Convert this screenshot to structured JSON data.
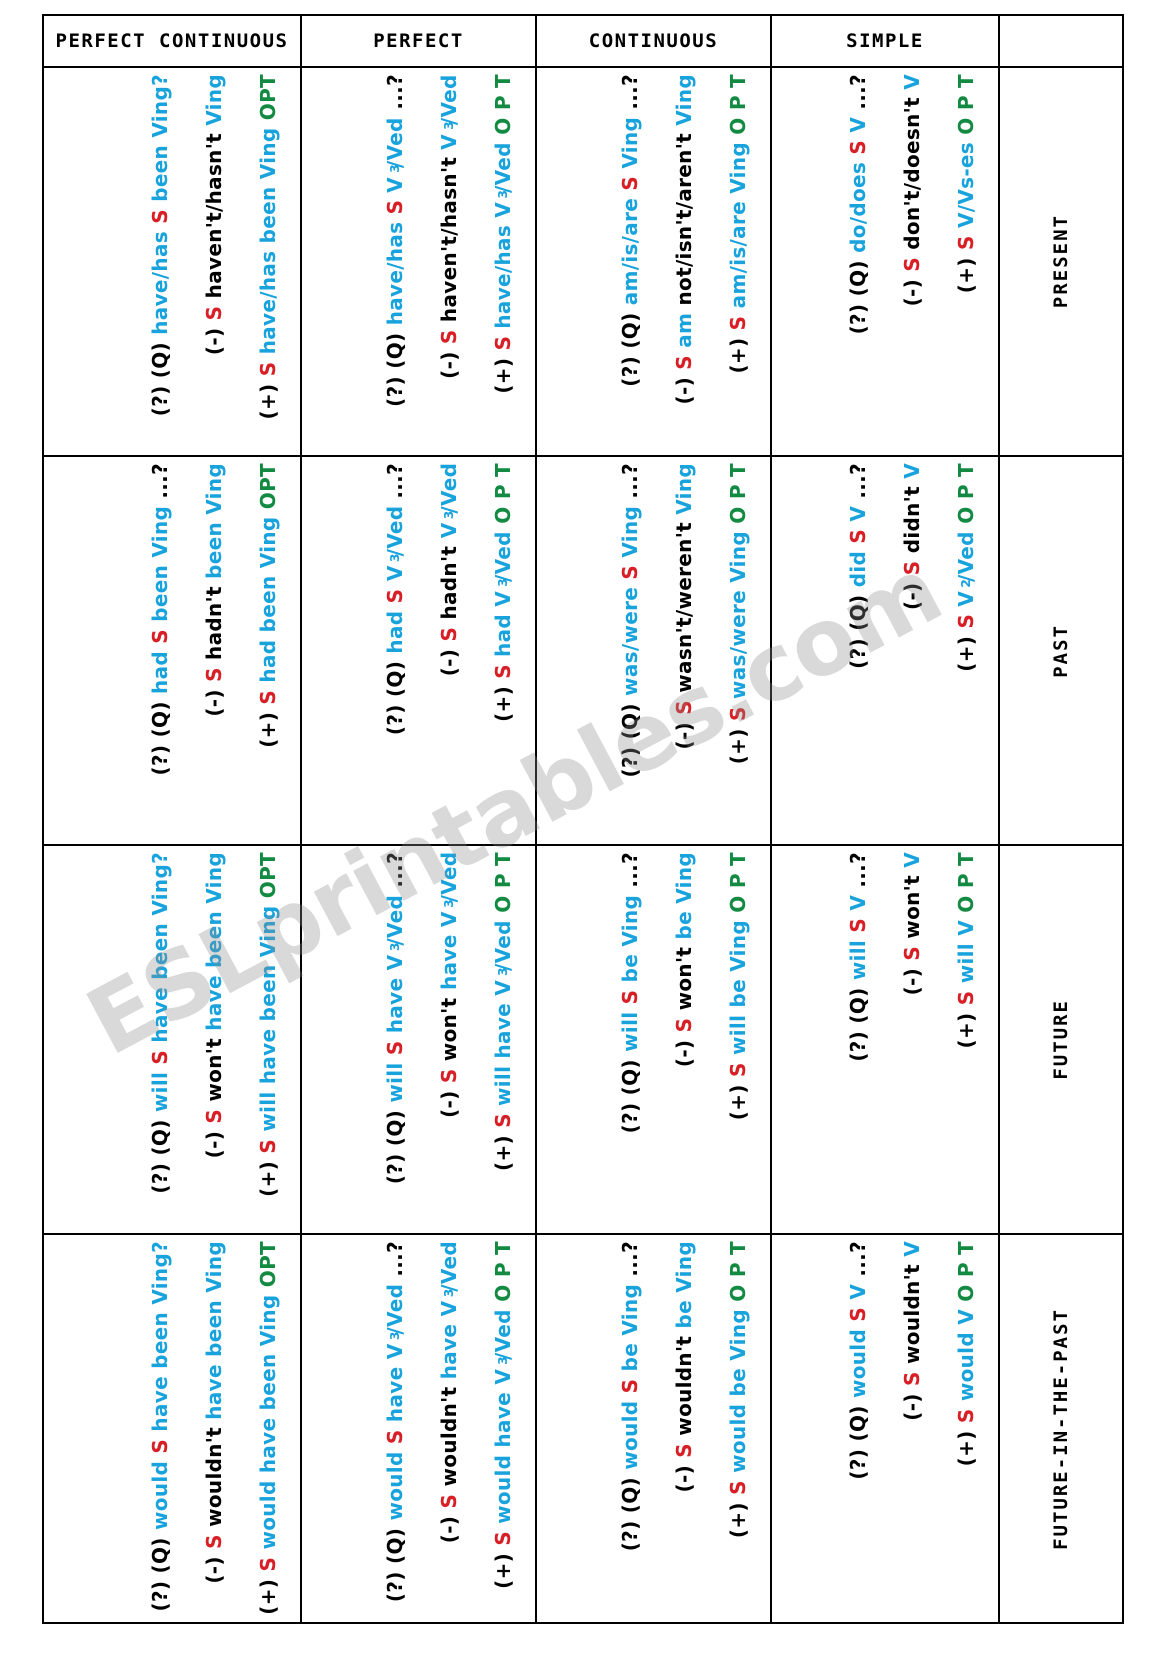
{
  "header": {
    "columns": [
      {
        "label": "PERFECT CONTINUOUS"
      },
      {
        "label": "PERFECT"
      },
      {
        "label": "CONTINUOUS"
      },
      {
        "label": "SIMPLE"
      },
      {
        "label": ""
      }
    ]
  },
  "legend": {
    "colors": {
      "subject": "#d81f26",
      "auxiliary": "#19a3dd",
      "negation": "#000000",
      "objects": "#128a42",
      "marker": "#000000"
    },
    "marks": {
      "affirmative": "(+)",
      "negative": "(-)",
      "question": "(?)",
      "wh": "(Q)"
    }
  },
  "watermark": {
    "text": "ESLprintables.com"
  },
  "rows": [
    {
      "label": "PRESENT",
      "cells": {
        "perfect_continuous": {
          "affirmative": {
            "mark": "(+)",
            "s": "S",
            "aux": "have/has been Ving",
            "neg": "",
            "opt": "OPT"
          },
          "negative": {
            "mark": "(-)",
            "s": "S",
            "aux": "",
            "neg": "haven't/hasn't",
            "aux2": "Ving"
          },
          "question": {
            "mark": "(?)",
            "wh": "(Q)",
            "aux": "have/has",
            "s": "S",
            "aux2": "been Ving?"
          }
        },
        "perfect": {
          "affirmative": {
            "mark": "(+)",
            "s": "S",
            "aux": "have/has V3/Ved",
            "neg": "",
            "opt": "O P T"
          },
          "negative": {
            "mark": "(-)",
            "s": "S",
            "aux": "",
            "neg": "haven't/hasn't",
            "aux2": "V3/Ved"
          },
          "question": {
            "mark": "(?)",
            "wh": "(Q)",
            "aux": "have/has",
            "s": "S",
            "aux2": "V3/Ved",
            "tail": "...?"
          }
        },
        "continuous": {
          "affirmative": {
            "mark": "(+)",
            "s": "S",
            "aux": "am/is/are Ving",
            "neg": "",
            "opt": "O P T"
          },
          "negative": {
            "mark": "(-)",
            "s": "S",
            "aux": "am",
            "neg": "not/isn't/aren't",
            "aux2": "Ving"
          },
          "question": {
            "mark": "(?)",
            "wh": "(Q)",
            "aux": "am/is/are",
            "s": "S",
            "aux2": "Ving",
            "tail": "...?"
          }
        },
        "simple": {
          "affirmative": {
            "mark": "(+)",
            "s": "S",
            "aux": "V/Vs-es",
            "neg": "",
            "opt": "O P T"
          },
          "negative": {
            "mark": "(-)",
            "s": "S",
            "aux": "",
            "neg": "don't/doesn't",
            "aux2": "V"
          },
          "question": {
            "mark": "(?)",
            "wh": "(Q)",
            "aux": "do/does",
            "s": "S",
            "aux2": "V",
            "tail": "...?"
          }
        }
      }
    },
    {
      "label": "PAST",
      "cells": {
        "perfect_continuous": {
          "affirmative": {
            "mark": "(+)",
            "s": "S",
            "aux": "had been Ving",
            "neg": "",
            "opt": "OPT"
          },
          "negative": {
            "mark": "(-)",
            "s": "S",
            "aux": "",
            "neg": "hadn't",
            "aux2": "been Ving"
          },
          "question": {
            "mark": "(?)",
            "wh": "(Q)",
            "aux": "had",
            "s": "S",
            "aux2": "been Ving",
            "tail": "...?"
          }
        },
        "perfect": {
          "affirmative": {
            "mark": "(+)",
            "s": "S",
            "aux": "had V3/Ved",
            "neg": "",
            "opt": "O P T"
          },
          "negative": {
            "mark": "(-)",
            "s": "S",
            "aux": "",
            "neg": "hadn't",
            "aux2": "V3/Ved"
          },
          "question": {
            "mark": "(?)",
            "wh": "(Q)",
            "aux": "had",
            "s": "S",
            "aux2": "V3/Ved",
            "tail": "...?"
          }
        },
        "continuous": {
          "affirmative": {
            "mark": "(+)",
            "s": "S",
            "aux": "was/were Ving",
            "neg": "",
            "opt": "O P T"
          },
          "negative": {
            "mark": "(-)",
            "s": "S",
            "aux": "",
            "neg": "wasn't/weren't",
            "aux2": "Ving"
          },
          "question": {
            "mark": "(?)",
            "wh": "(Q)",
            "aux": "was/were",
            "s": "S",
            "aux2": "Ving",
            "tail": "...?"
          }
        },
        "simple": {
          "affirmative": {
            "mark": "(+)",
            "s": "S",
            "aux": "V2/Ved",
            "neg": "",
            "opt": "O P T"
          },
          "negative": {
            "mark": "(-)",
            "s": "S",
            "aux": "",
            "neg": "didn't",
            "aux2": "V"
          },
          "question": {
            "mark": "(?)",
            "wh": "(Q)",
            "aux": "did",
            "s": "S",
            "aux2": "V",
            "tail": "...?"
          }
        }
      }
    },
    {
      "label": "FUTURE",
      "cells": {
        "perfect_continuous": {
          "affirmative": {
            "mark": "(+)",
            "s": "S",
            "aux": "will have been Ving",
            "neg": "",
            "opt": "OPT"
          },
          "negative": {
            "mark": "(-)",
            "s": "S",
            "aux": "",
            "neg": "won't",
            "aux2": "have been Ving"
          },
          "question": {
            "mark": "(?)",
            "wh": "(Q)",
            "aux": "will",
            "s": "S",
            "aux2": "have been Ving?"
          }
        },
        "perfect": {
          "affirmative": {
            "mark": "(+)",
            "s": "S",
            "aux": "will have V3/Ved",
            "neg": "",
            "opt": "O P T"
          },
          "negative": {
            "mark": "(-)",
            "s": "S",
            "aux": "",
            "neg": "won't",
            "aux2": "have V3/Ved"
          },
          "question": {
            "mark": "(?)",
            "wh": "(Q)",
            "aux": "will",
            "s": "S",
            "aux2": "have V3/Ved",
            "tail": "...?"
          }
        },
        "continuous": {
          "affirmative": {
            "mark": "(+)",
            "s": "S",
            "aux": "will be Ving",
            "neg": "",
            "opt": "O P T"
          },
          "negative": {
            "mark": "(-)",
            "s": "S",
            "aux": "",
            "neg": "won't",
            "aux2": "be Ving"
          },
          "question": {
            "mark": "(?)",
            "wh": "(Q)",
            "aux": "will",
            "s": "S",
            "aux2": "be Ving",
            "tail": "...?"
          }
        },
        "simple": {
          "affirmative": {
            "mark": "(+)",
            "s": "S",
            "aux": "will V",
            "neg": "",
            "opt": "O P T"
          },
          "negative": {
            "mark": "(-)",
            "s": "S",
            "aux": "",
            "neg": "won't",
            "aux2": "V"
          },
          "question": {
            "mark": "(?)",
            "wh": "(Q)",
            "aux": "will",
            "s": "S",
            "aux2": "V",
            "tail": "...?"
          }
        }
      }
    },
    {
      "label": "FUTURE-IN-THE-PAST",
      "cells": {
        "perfect_continuous": {
          "affirmative": {
            "mark": "(+)",
            "s": "S",
            "aux": "would have been Ving",
            "neg": "",
            "opt": "OPT"
          },
          "negative": {
            "mark": "(-)",
            "s": "S",
            "aux": "",
            "neg": "wouldn't",
            "aux2": "have been Ving"
          },
          "question": {
            "mark": "(?)",
            "wh": "(Q)",
            "aux": "would",
            "s": "S",
            "aux2": "have been Ving?"
          }
        },
        "perfect": {
          "affirmative": {
            "mark": "(+)",
            "s": "S",
            "aux": "would have V3/Ved",
            "neg": "",
            "opt": "O P T"
          },
          "negative": {
            "mark": "(-)",
            "s": "S",
            "aux": "",
            "neg": "wouldn't",
            "aux2": "have V3/Ved"
          },
          "question": {
            "mark": "(?)",
            "wh": "(Q)",
            "aux": "would",
            "s": "S",
            "aux2": "have V3/Ved",
            "tail": "...?"
          }
        },
        "continuous": {
          "affirmative": {
            "mark": "(+)",
            "s": "S",
            "aux": "would be Ving",
            "neg": "",
            "opt": "O P T"
          },
          "negative": {
            "mark": "(-)",
            "s": "S",
            "aux": "",
            "neg": "wouldn't",
            "aux2": "be Ving"
          },
          "question": {
            "mark": "(?)",
            "wh": "(Q)",
            "aux": "would",
            "s": "S",
            "aux2": "be Ving",
            "tail": "...?"
          }
        },
        "simple": {
          "affirmative": {
            "mark": "(+)",
            "s": "S",
            "aux": "would V",
            "neg": "",
            "opt": "O P T"
          },
          "negative": {
            "mark": "(-)",
            "s": "S",
            "aux": "",
            "neg": "wouldn't",
            "aux2": "V"
          },
          "question": {
            "mark": "(?)",
            "wh": "(Q)",
            "aux": "would",
            "s": "S",
            "aux2": "V",
            "tail": "...?"
          }
        }
      }
    }
  ]
}
